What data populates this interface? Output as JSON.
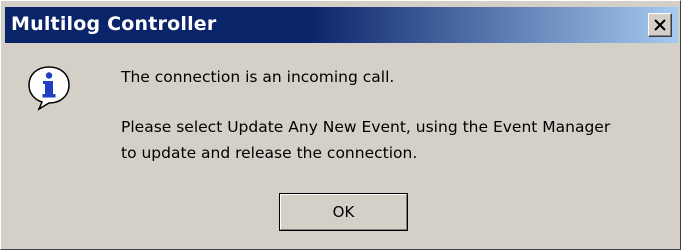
{
  "window": {
    "title": "Multilog Controller",
    "close_label": "×"
  },
  "icon": {
    "name": "info-icon",
    "glyph": "i",
    "color": "#1e3fbf"
  },
  "message": {
    "line1": "The connection is an incoming call.",
    "line2": "Please select Update Any New Event, using the Event Manager",
    "line3": "to update and release the connection."
  },
  "buttons": {
    "ok_label": "OK"
  },
  "colors": {
    "titlebar_start": "#0a246a",
    "titlebar_end": "#a6caf0",
    "dialog_bg": "#d4d0c8"
  }
}
